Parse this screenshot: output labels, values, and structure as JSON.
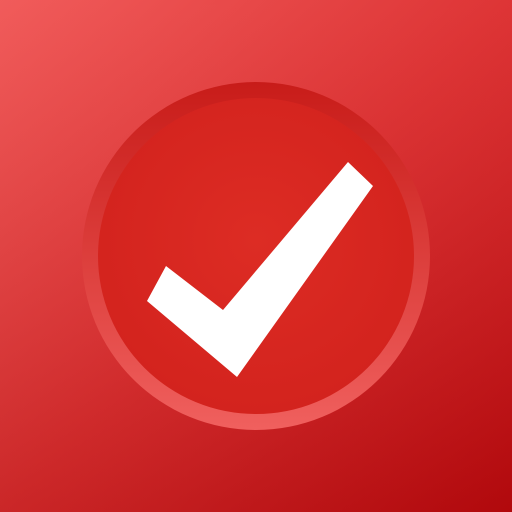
{
  "icon": {
    "semantic_name": "checkmark-icon",
    "colors": {
      "background_top": "#f05352",
      "background_bottom": "#c0090d",
      "ring": "#e74645",
      "disc": "#d9261f",
      "check": "#ffffff"
    }
  }
}
